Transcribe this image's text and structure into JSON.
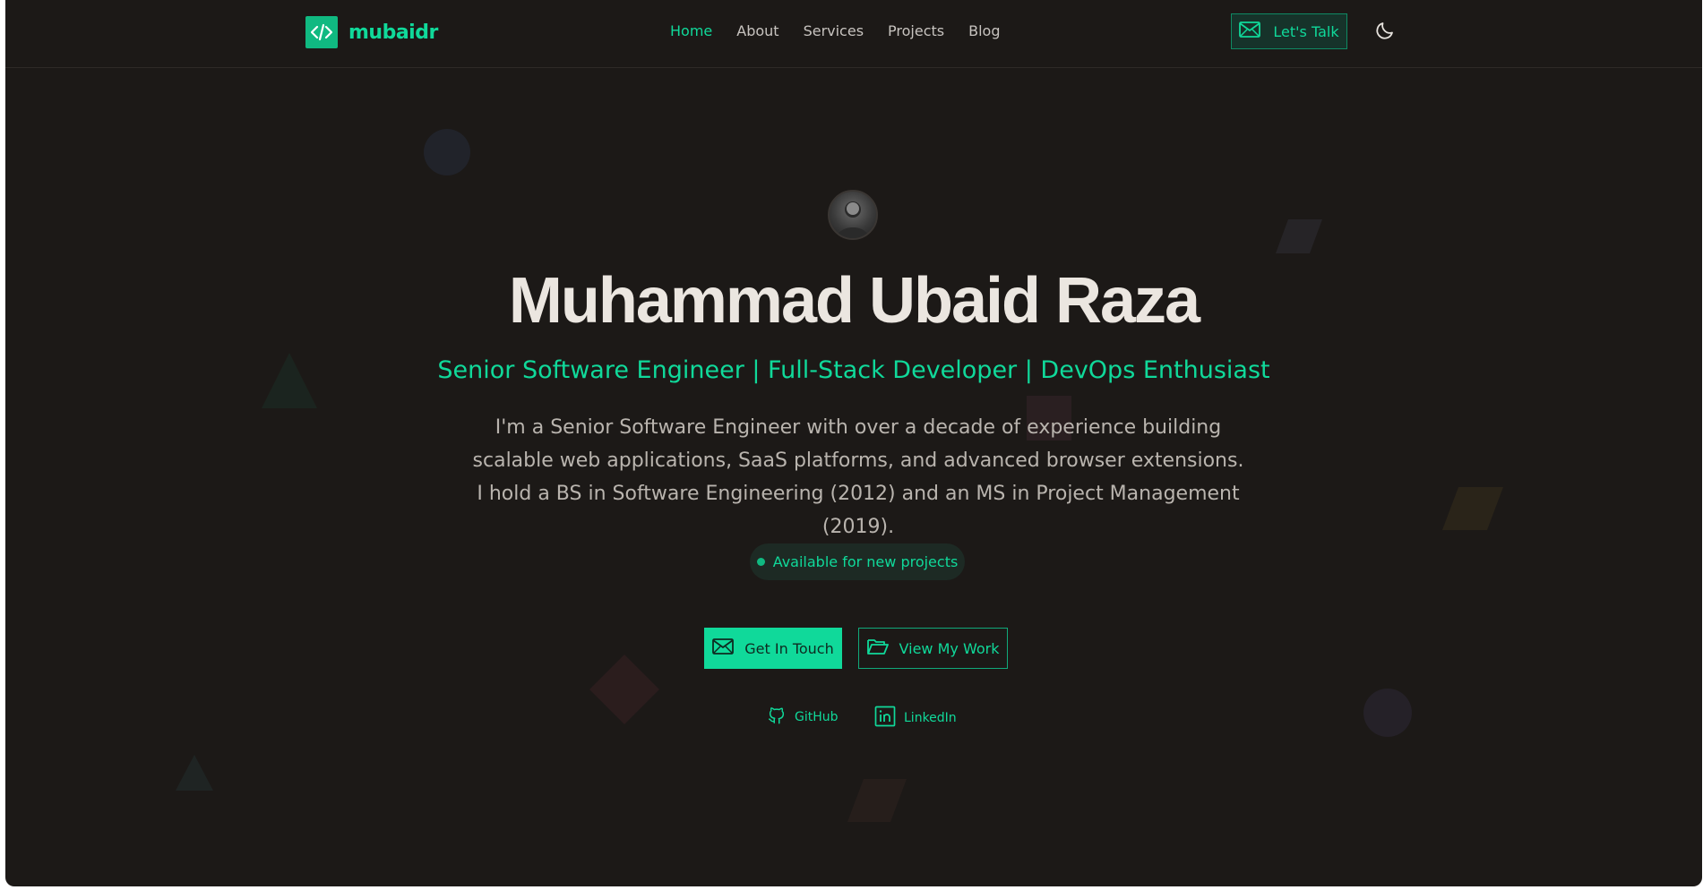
{
  "header": {
    "brand": {
      "logo_icon": "code-icon",
      "name": "mubaidr"
    },
    "nav": [
      {
        "label": "Home",
        "active": true
      },
      {
        "label": "About",
        "active": false
      },
      {
        "label": "Services",
        "active": false
      },
      {
        "label": "Projects",
        "active": false
      },
      {
        "label": "Blog",
        "active": false
      }
    ],
    "cta": {
      "icon": "mail-icon",
      "label": "Let's Talk"
    },
    "theme_toggle": {
      "icon": "moon-icon"
    }
  },
  "hero": {
    "avatar": {
      "description": "profile photo"
    },
    "name": "Muhammad Ubaid Raza",
    "subtitle": "Senior Software Engineer | Full-Stack Developer | DevOps Enthusiast",
    "bio": "I'm a Senior Software Engineer with over a decade of experience building scalable web applications, SaaS platforms, and advanced browser extensions. I hold a BS in Software Engineering (2012) and an MS in Project Management (2019).",
    "status": "Available for new projects",
    "primary_button": {
      "icon": "mail-icon",
      "label": "Get In Touch"
    },
    "secondary_button": {
      "icon": "folder-open-icon",
      "label": "View My Work"
    },
    "social_links": [
      {
        "icon": "github-icon",
        "label": "GitHub"
      },
      {
        "icon": "linkedin-icon",
        "label": "LinkedIn"
      }
    ]
  },
  "colors": {
    "background": "#1c1917",
    "accent": "#10d99a",
    "text": "#ebe6e0",
    "muted_text": "#b9b4ae"
  }
}
